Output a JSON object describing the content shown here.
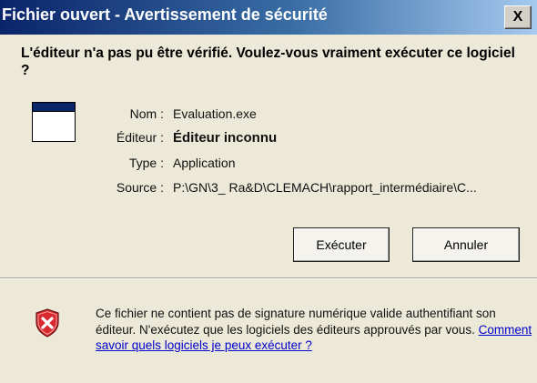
{
  "window": {
    "title": "Fichier ouvert - Avertissement de sécurité",
    "close_label": "X"
  },
  "question": "L'éditeur n'a pas pu être vérifié. Voulez-vous vraiment exécuter ce logiciel ?",
  "file_info": {
    "name_label": "Nom :",
    "name_value": "Evaluation.exe",
    "publisher_label": "Éditeur :",
    "publisher_value": "Éditeur inconnu",
    "type_label": "Type :",
    "type_value": "Application",
    "source_label": "Source :",
    "source_value": "P:\\GN\\3_ Ra&D\\CLEMACH\\rapport_intermédiaire\\C..."
  },
  "buttons": {
    "run_label": "Exécuter",
    "cancel_label": "Annuler"
  },
  "warning": {
    "text": "Ce fichier ne contient pas de signature numérique valide authentifiant son éditeur. N'exécutez que les logiciels des éditeurs approuvés par vous.",
    "link_text": "Comment savoir quels logiciels je peux exécuter ?"
  },
  "icons": {
    "app": "application-window-icon",
    "warning": "security-shield-icon"
  },
  "colors": {
    "titlebar_start": "#0a246a",
    "titlebar_end": "#a6caf0",
    "dialog_background": "#ece9d8",
    "shield_red": "#d8292f",
    "link": "#0000cc"
  }
}
